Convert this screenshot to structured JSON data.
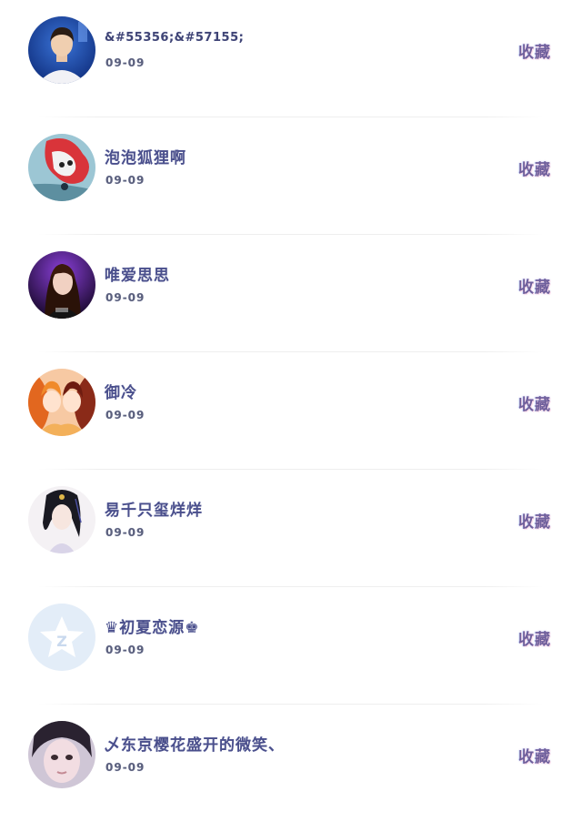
{
  "list": {
    "rows": [
      {
        "name": "&#55356;&#57155;",
        "date": "09-09",
        "action": "收藏",
        "avatar_icon": "boy-photo-avatar-icon"
      },
      {
        "name": "泡泡狐狸啊",
        "date": "09-09",
        "action": "收藏",
        "avatar_icon": "red-cartoon-cat-avatar-icon"
      },
      {
        "name": "唯爱思思",
        "date": "09-09",
        "action": "收藏",
        "avatar_icon": "purple-girl-avatar-icon"
      },
      {
        "name": "御冷",
        "date": "09-09",
        "action": "收藏",
        "avatar_icon": "anime-twins-avatar-icon"
      },
      {
        "name": "易千只玺烊烊",
        "date": "09-09",
        "action": "收藏",
        "avatar_icon": "ancient-lady-avatar-icon"
      },
      {
        "name": "♛初夏恋源♚",
        "date": "09-09",
        "action": "收藏",
        "avatar_icon": "default-star-avatar-icon"
      },
      {
        "name": "乄东京樱花盛开的微笑、",
        "date": "09-09",
        "action": "收藏",
        "avatar_icon": "girl-selfie-avatar-icon"
      }
    ]
  }
}
